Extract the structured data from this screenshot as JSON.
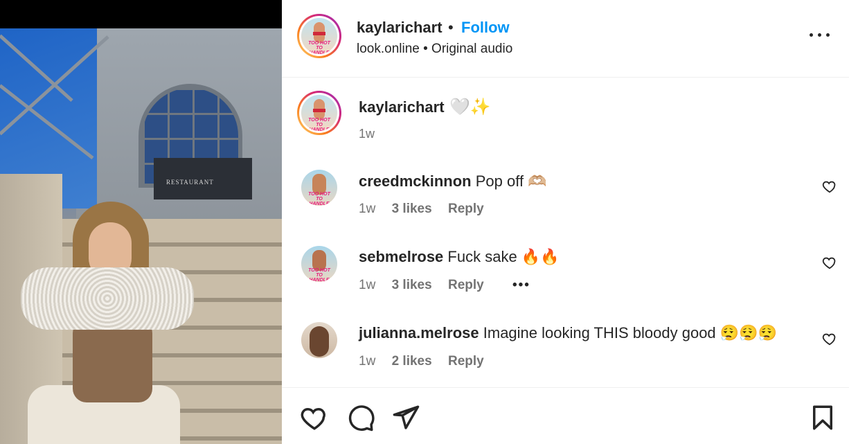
{
  "post": {
    "username": "kaylarichart",
    "dot": "•",
    "follow_label": "Follow",
    "subtitle": "look.online • Original audio",
    "avatar_badge": "TOO HOT TO HANDLE",
    "photo_sign": "RESTAURANT"
  },
  "caption": {
    "username": "kaylarichart",
    "emojis": "🤍✨",
    "time": "1w"
  },
  "comments": [
    {
      "username": "creedmckinnon",
      "text": "Pop off 🫶🏼",
      "time": "1w",
      "likes": "3 likes",
      "reply": "Reply",
      "badge": "TOO HOT TO HANDLE"
    },
    {
      "username": "sebmelrose",
      "text": "Fuck sake 🔥🔥",
      "time": "1w",
      "likes": "3 likes",
      "reply": "Reply",
      "more": "•••",
      "badge": "TOO HOT TO HANDLE"
    },
    {
      "username": "julianna.melrose",
      "text": "Imagine looking THIS bloody good 😮‍💨😮‍💨😮‍💨",
      "time": "1w",
      "likes": "2 likes",
      "reply": "Reply"
    }
  ],
  "icons": {
    "more": "more-options-icon",
    "like": "heart-icon",
    "comment": "comment-icon",
    "share": "send-icon",
    "save": "bookmark-icon"
  },
  "colors": {
    "follow": "#0095f6",
    "muted": "#737373",
    "text": "#262626"
  }
}
